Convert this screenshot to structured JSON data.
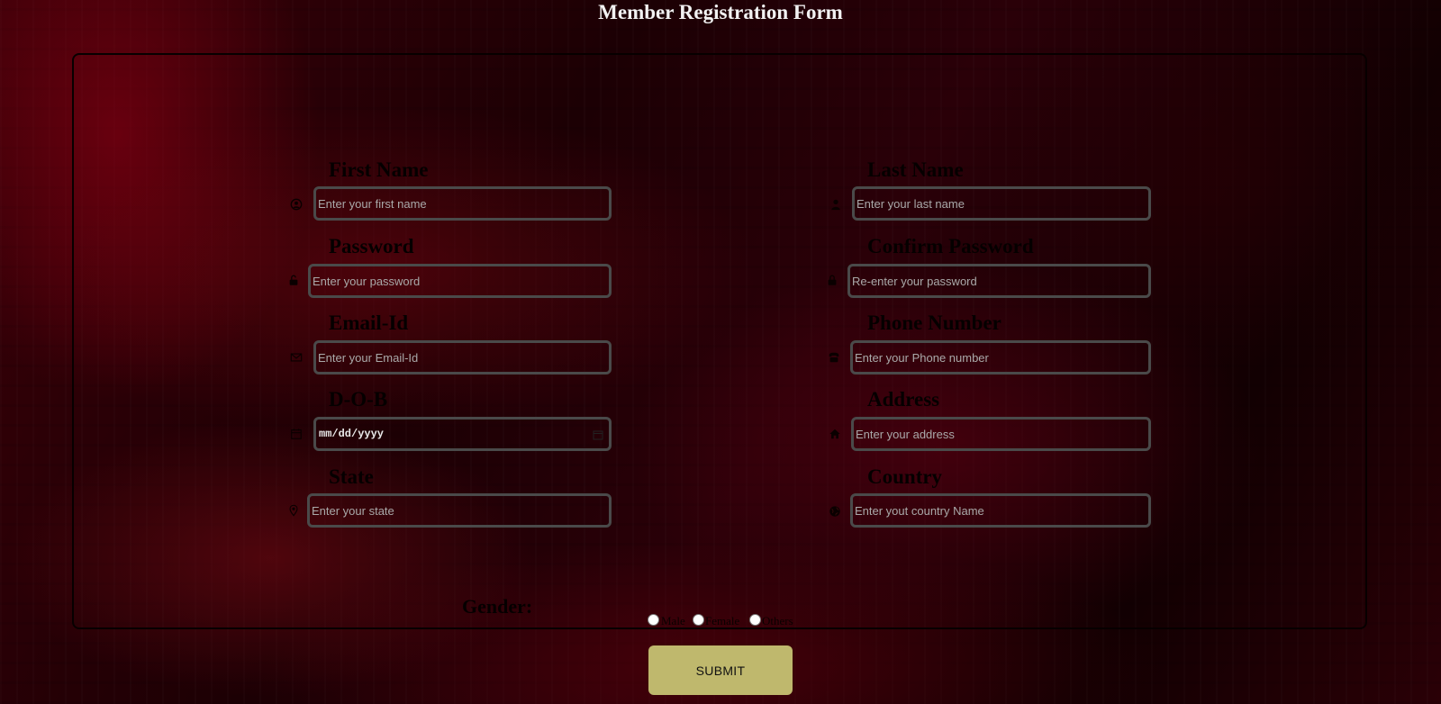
{
  "page": {
    "title": "Member Registration Form"
  },
  "fields": {
    "first_name": {
      "label": "First Name",
      "placeholder": "Enter your first name",
      "icon": "user-circle-icon"
    },
    "last_name": {
      "label": "Last Name",
      "placeholder": "Enter your last name",
      "icon": "user-icon"
    },
    "password": {
      "label": "Password",
      "placeholder": "Enter your password",
      "icon": "unlock-icon"
    },
    "confirm_password": {
      "label": "Confirm Password",
      "placeholder": "Re-enter your password",
      "icon": "lock-icon"
    },
    "email": {
      "label": "Email-Id",
      "placeholder": "Enter your Email-Id",
      "icon": "envelope-icon"
    },
    "phone": {
      "label": "Phone Number",
      "placeholder": "Enter your Phone number",
      "icon": "phone-icon"
    },
    "dob": {
      "label": "D-O-B",
      "value": "mm/dd/yyyy",
      "icon": "calendar-icon"
    },
    "address": {
      "label": "Address",
      "placeholder": "Enter your address",
      "icon": "home-icon"
    },
    "state": {
      "label": "State",
      "placeholder": "Enter your state",
      "icon": "map-pin-icon"
    },
    "country": {
      "label": "Country",
      "placeholder": "Enter yout country Name",
      "icon": "globe-icon"
    }
  },
  "gender": {
    "label": "Gender:",
    "options": [
      "Male",
      "Female",
      "Others"
    ]
  },
  "submit": {
    "label": "SUBMIT"
  },
  "colors": {
    "accent": "#bfb86d",
    "input_border": "#4a4a4a",
    "background_dark": "#1c0004",
    "background_red": "#7a0010"
  }
}
